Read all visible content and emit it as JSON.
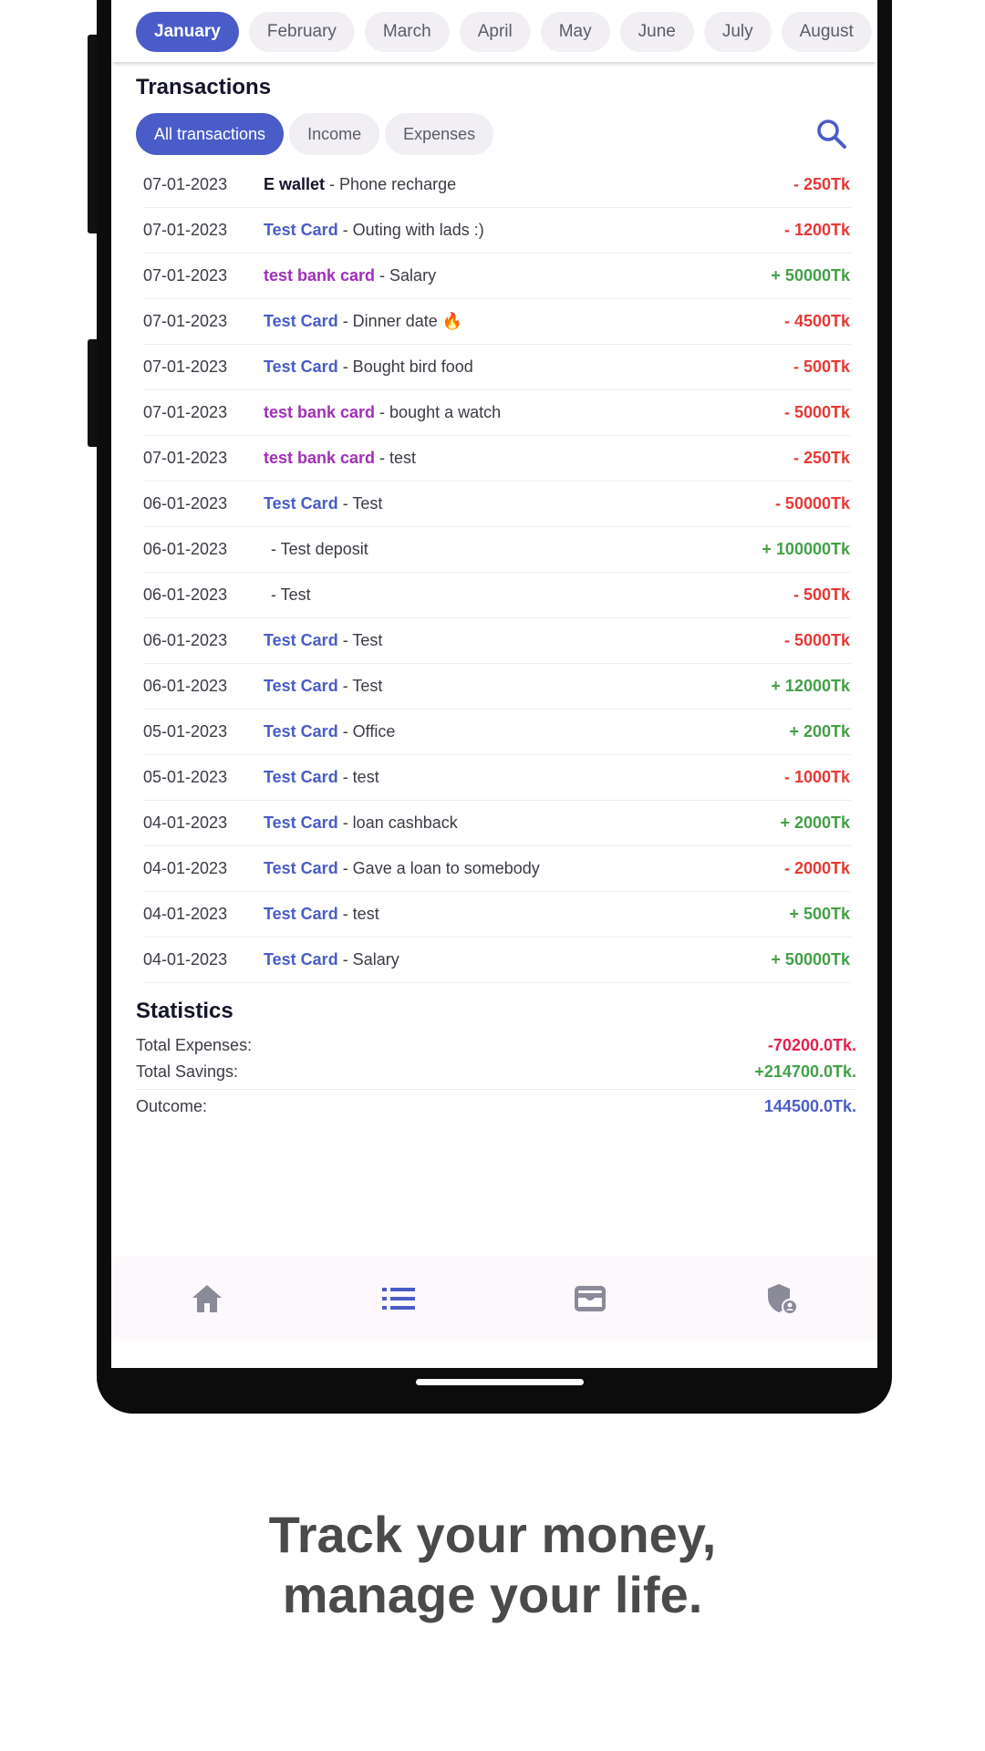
{
  "months": [
    "January",
    "February",
    "March",
    "April",
    "May",
    "June",
    "July",
    "August"
  ],
  "active_month": "January",
  "transactions_title": "Transactions",
  "filters": [
    "All transactions",
    "Income",
    "Expenses"
  ],
  "transactions": [
    {
      "date": "07-01-2023",
      "card": "E wallet",
      "card_color": "#14142a",
      "desc": "- Phone recharge",
      "amount": "- 250Tk",
      "type": "neg"
    },
    {
      "date": "07-01-2023",
      "card": "Test Card",
      "card_color": "#4a5cc7",
      "desc": "- Outing with lads :)",
      "amount": "- 1200Tk",
      "type": "neg"
    },
    {
      "date": "07-01-2023",
      "card": "test bank card",
      "card_color": "#a030b8",
      "desc": "- Salary",
      "amount": "+ 50000Tk",
      "type": "pos"
    },
    {
      "date": "07-01-2023",
      "card": "Test Card",
      "card_color": "#4a5cc7",
      "desc": "- Dinner date 🔥",
      "amount": "- 4500Tk",
      "type": "neg"
    },
    {
      "date": "07-01-2023",
      "card": "Test Card",
      "card_color": "#4a5cc7",
      "desc": "- Bought bird food",
      "amount": "- 500Tk",
      "type": "neg"
    },
    {
      "date": "07-01-2023",
      "card": "test bank card",
      "card_color": "#a030b8",
      "desc": "- bought a watch",
      "amount": "- 5000Tk",
      "type": "neg"
    },
    {
      "date": "07-01-2023",
      "card": "test bank card",
      "card_color": "#a030b8",
      "desc": "- test",
      "amount": "- 250Tk",
      "type": "neg"
    },
    {
      "date": "06-01-2023",
      "card": "Test Card",
      "card_color": "#4a5cc7",
      "desc": "- Test",
      "amount": "- 50000Tk",
      "type": "neg"
    },
    {
      "date": "06-01-2023",
      "card": "",
      "card_color": "#4a5cc7",
      "desc": "- Test deposit",
      "amount": "+ 100000Tk",
      "type": "pos"
    },
    {
      "date": "06-01-2023",
      "card": "",
      "card_color": "#4a5cc7",
      "desc": "- Test",
      "amount": "- 500Tk",
      "type": "neg"
    },
    {
      "date": "06-01-2023",
      "card": "Test Card",
      "card_color": "#4a5cc7",
      "desc": "- Test",
      "amount": "- 5000Tk",
      "type": "neg"
    },
    {
      "date": "06-01-2023",
      "card": "Test Card",
      "card_color": "#4a5cc7",
      "desc": "- Test",
      "amount": "+ 12000Tk",
      "type": "pos"
    },
    {
      "date": "05-01-2023",
      "card": "Test Card",
      "card_color": "#4a5cc7",
      "desc": "- Office",
      "amount": "+ 200Tk",
      "type": "pos"
    },
    {
      "date": "05-01-2023",
      "card": "Test Card",
      "card_color": "#4a5cc7",
      "desc": "- test",
      "amount": "- 1000Tk",
      "type": "neg"
    },
    {
      "date": "04-01-2023",
      "card": "Test Card",
      "card_color": "#4a5cc7",
      "desc": "- loan cashback",
      "amount": "+ 2000Tk",
      "type": "pos"
    },
    {
      "date": "04-01-2023",
      "card": "Test Card",
      "card_color": "#4a5cc7",
      "desc": "- Gave a loan to somebody",
      "amount": "- 2000Tk",
      "type": "neg"
    },
    {
      "date": "04-01-2023",
      "card": "Test Card",
      "card_color": "#4a5cc7",
      "desc": "- test",
      "amount": "+ 500Tk",
      "type": "pos"
    },
    {
      "date": "04-01-2023",
      "card": "Test Card",
      "card_color": "#4a5cc7",
      "desc": "- Salary",
      "amount": "+ 50000Tk",
      "type": "pos"
    }
  ],
  "statistics": {
    "title": "Statistics",
    "total_expenses_label": "Total Expenses:",
    "total_expenses_value": "-70200.0Tk.",
    "total_savings_label": "Total Savings:",
    "total_savings_value": "+214700.0Tk.",
    "outcome_label": "Outcome:",
    "outcome_value": "144500.0Tk."
  },
  "colors": {
    "accent": "#4a5cc7",
    "expense": "#e53935",
    "income": "#43a047",
    "stat_expense": "#e5224e",
    "stat_savings": "#43a047",
    "stat_outcome": "#4a5cc7",
    "nav_icon": "#8a8a99"
  },
  "nav": [
    "home-icon",
    "list-icon",
    "wallet-icon",
    "shield-user-icon"
  ],
  "tagline": {
    "line1": "Track your money,",
    "line2": "manage your life."
  }
}
